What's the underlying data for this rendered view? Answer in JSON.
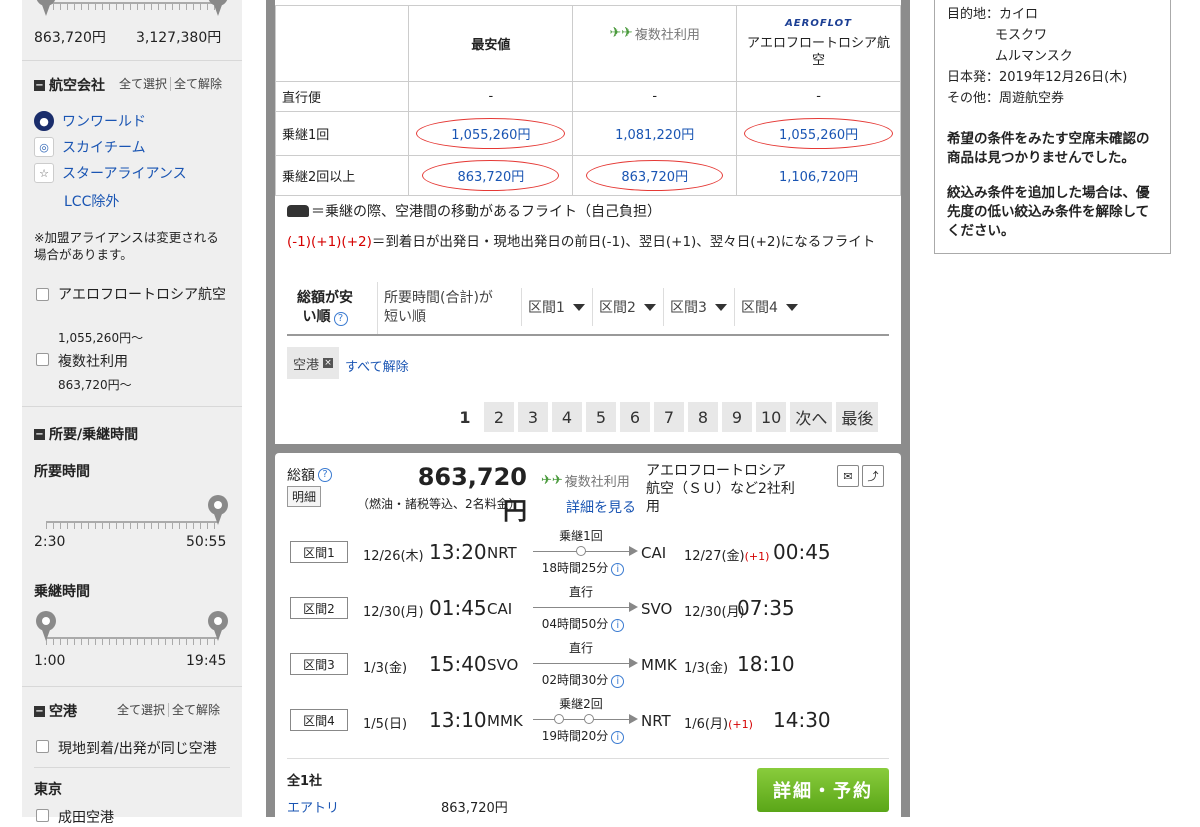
{
  "sidebar": {
    "price_range": {
      "min": "863,720円",
      "max": "3,127,380円"
    },
    "airline": {
      "heading": "航空会社",
      "select_all": "全て選択",
      "clear_all": "全て解除",
      "alliances": [
        {
          "label": "ワンワールド",
          "icon": "oneworld-icon"
        },
        {
          "label": "スカイチーム",
          "icon": "skyteam-icon"
        },
        {
          "label": "スターアライアンス",
          "icon": "star-alliance-icon"
        }
      ],
      "lcc_exclude": "LCC除外",
      "note": "※加盟アライアンスは変更される場合があります。",
      "options": [
        {
          "label": "アエロフロートロシア航空",
          "price": "1,055,260円〜"
        },
        {
          "label": "複数社利用",
          "price": "863,720円〜"
        }
      ]
    },
    "duration": {
      "heading": "所要/乗継時間",
      "total_label": "所要時間",
      "total_min": "2:30",
      "total_max": "50:55",
      "transfer_label": "乗継時間",
      "transfer_min": "1:00",
      "transfer_max": "19:45"
    },
    "airport": {
      "heading": "空港",
      "select_all": "全て選択",
      "clear_all": "全て解除",
      "same_airport": "現地到着/出発が同じ空港",
      "region": "東京",
      "first_airport": "成田空港"
    }
  },
  "compare": {
    "headers": [
      "",
      "最安値",
      "複数社利用",
      "アエロフロートロシア航空"
    ],
    "aeroflot_logo": "AEROFLOT",
    "rows": [
      {
        "label": "直行便",
        "cells": [
          "-",
          "-",
          "-"
        ]
      },
      {
        "label": "乗継1回",
        "cells": [
          "1,055,260円",
          "1,081,220円",
          "1,055,260円"
        ]
      },
      {
        "label": "乗継2回以上",
        "cells": [
          "863,720円",
          "863,720円",
          "1,106,720円"
        ]
      }
    ]
  },
  "legend": {
    "car_text": "＝乗継の際、空港間の移動があるフライト（自己負担）",
    "day_codes": "(-1)(+1)(+2)",
    "day_text": "＝到着日が出発日・現地出発日の前日(-1)、翌日(+1)、翌々日(+2)になるフライト"
  },
  "sort_tabs": [
    {
      "label": "総額が安い順"
    },
    {
      "label": "所要時間(合計)が短い順"
    },
    {
      "label": "区間1"
    },
    {
      "label": "区間2"
    },
    {
      "label": "区間3"
    },
    {
      "label": "区間4"
    }
  ],
  "filter_chip": {
    "label": "空港",
    "clear_all": "すべて解除"
  },
  "pager": {
    "pages": [
      "1",
      "2",
      "3",
      "4",
      "5",
      "6",
      "7",
      "8",
      "9",
      "10"
    ],
    "next": "次へ",
    "last": "最後",
    "current": "1"
  },
  "result": {
    "total_label": "総額",
    "detail_label": "明細",
    "price": "863,720円",
    "price_note": "（燃油・諸税等込、2名料金）",
    "carrier_badge": "複数社利用",
    "see_detail": "詳細を見る",
    "airline_text": "アエロフロートロシア航空（ＳＵ）など2社利用",
    "segments": [
      {
        "label": "区間1",
        "dep_date": "12/26(木)",
        "dep_time": "13:20",
        "dep_ap": "NRT",
        "stop": "乗継1回",
        "duration": "18時間25分",
        "arr_ap": "CAI",
        "arr_date": "12/27(金)",
        "plus": "(+1)",
        "arr_time": "00:45",
        "dots": 1
      },
      {
        "label": "区間2",
        "dep_date": "12/30(月)",
        "dep_time": "01:45",
        "dep_ap": "CAI",
        "stop": "直行",
        "duration": "04時間50分",
        "arr_ap": "SVO",
        "arr_date": "12/30(月)",
        "plus": "",
        "arr_time": "07:35",
        "dots": 0
      },
      {
        "label": "区間3",
        "dep_date": "1/3(金)",
        "dep_time": "15:40",
        "dep_ap": "SVO",
        "stop": "直行",
        "duration": "02時間30分",
        "arr_ap": "MMK",
        "arr_date": "1/3(金)",
        "plus": "",
        "arr_time": "18:10",
        "dots": 0
      },
      {
        "label": "区間4",
        "dep_date": "1/5(日)",
        "dep_time": "13:10",
        "dep_ap": "MMK",
        "stop": "乗継2回",
        "duration": "19時間20分",
        "arr_ap": "NRT",
        "arr_date": "1/6(月)",
        "plus": "(+1)",
        "arr_time": "14:30",
        "dots": 2
      }
    ],
    "seller_count": "全1社",
    "seller_name": "エアトリ",
    "seller_price": "863,720円",
    "book_button": "詳細・予約"
  },
  "conditions": {
    "dest_label": "目的地：",
    "destinations": [
      "カイロ",
      "モスクワ",
      "ムルマンスク"
    ],
    "departure": "日本発：2019年12月26日(木)",
    "other": "その他：周遊航空券",
    "msg1": "希望の条件をみたす空席未確認の商品は見つかりませんでした。",
    "msg2": "絞込み条件を追加した場合は、優先度の低い絞込み条件を解除してください。"
  },
  "colors": {
    "link": "#1a55b3",
    "highlight": "#e53935",
    "book": "#6cb52a"
  }
}
